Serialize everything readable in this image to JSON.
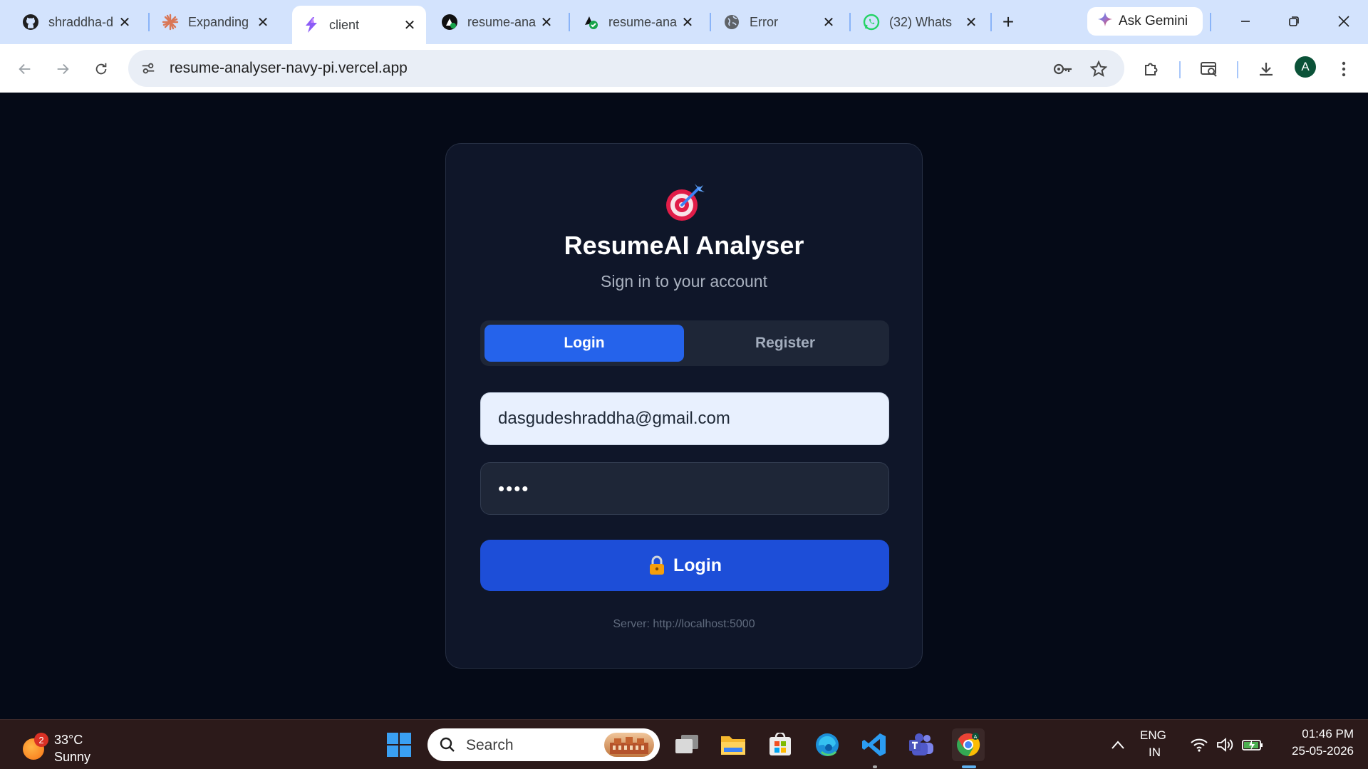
{
  "browser": {
    "tabs": [
      {
        "title": "shraddha-d",
        "icon": "github-icon"
      },
      {
        "title": "Expanding",
        "icon": "claude-icon"
      },
      {
        "title": "client",
        "icon": "vite-icon",
        "active": true
      },
      {
        "title": "resume-ana",
        "icon": "render-icon"
      },
      {
        "title": "resume-ana",
        "icon": "vercel-icon"
      },
      {
        "title": "Error",
        "icon": "globe-icon"
      },
      {
        "title": "(32) Whats",
        "icon": "whatsapp-icon"
      }
    ],
    "gemini_label": "Ask Gemini",
    "url": "resume-analyser-navy-pi.vercel.app",
    "profile_initial": "A"
  },
  "app": {
    "title": "ResumeAI Analyser",
    "subtitle": "Sign in to your account",
    "tabs": {
      "login": "Login",
      "register": "Register"
    },
    "email_value": "dasgudeshraddha@gmail.com",
    "password_mask": "••••",
    "submit_label": "Login",
    "server_text": "Server: http://localhost:5000",
    "colors": {
      "accent": "#2563eb",
      "submit": "#1d4ed8",
      "card": "#0f1629",
      "background": "#050a17"
    }
  },
  "taskbar": {
    "weather": {
      "badge": "2",
      "temp": "33°C",
      "condition": "Sunny"
    },
    "search_label": "Search",
    "lang_top": "ENG",
    "lang_bottom": "IN",
    "time": "01:46 PM",
    "date": "25-05-2026"
  }
}
